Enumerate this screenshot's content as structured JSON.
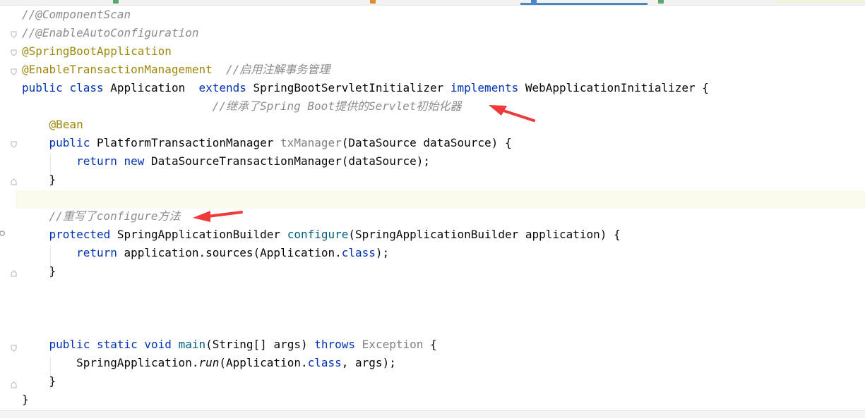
{
  "editor": {
    "lines": [
      {
        "segments": [
          {
            "t": "//@ComponentScan",
            "c": "cm"
          }
        ]
      },
      {
        "segments": [
          {
            "t": "//@EnableAutoConfiguration",
            "c": "cm"
          }
        ]
      },
      {
        "segments": [
          {
            "t": "@SpringBootApplication",
            "c": "an"
          }
        ]
      },
      {
        "segments": [
          {
            "t": "@EnableTransactionManagement",
            "c": "an"
          },
          {
            "t": "  ",
            "c": ""
          },
          {
            "t": "//启用注解事务管理",
            "c": "cm"
          }
        ]
      },
      {
        "segments": [
          {
            "t": "public",
            "c": "kw"
          },
          {
            "t": " ",
            "c": ""
          },
          {
            "t": "class",
            "c": "kw"
          },
          {
            "t": " Application  ",
            "c": ""
          },
          {
            "t": "extends",
            "c": "kw"
          },
          {
            "t": " SpringBootServletInitializer ",
            "c": ""
          },
          {
            "t": "implements",
            "c": "kw"
          },
          {
            "t": " WebApplicationInitializer {",
            "c": ""
          }
        ]
      },
      {
        "segments": [
          {
            "t": "                            ",
            "c": ""
          },
          {
            "t": "//继承了Spring Boot提供的Servlet初始化器",
            "c": "cm"
          }
        ]
      },
      {
        "segments": [
          {
            "t": "    ",
            "c": ""
          },
          {
            "t": "@Bean",
            "c": "an"
          }
        ]
      },
      {
        "segments": [
          {
            "t": "    ",
            "c": ""
          },
          {
            "t": "public",
            "c": "kw"
          },
          {
            "t": " PlatformTransactionManager ",
            "c": ""
          },
          {
            "t": "txManager",
            "c": "un"
          },
          {
            "t": "(DataSource dataSource) {",
            "c": ""
          }
        ]
      },
      {
        "segments": [
          {
            "t": "        ",
            "c": ""
          },
          {
            "t": "return",
            "c": "kw"
          },
          {
            "t": " ",
            "c": ""
          },
          {
            "t": "new",
            "c": "kw"
          },
          {
            "t": " DataSourceTransactionManager(dataSource);",
            "c": ""
          }
        ]
      },
      {
        "segments": [
          {
            "t": "    }",
            "c": ""
          }
        ]
      },
      {
        "segments": []
      },
      {
        "segments": [
          {
            "t": "    ",
            "c": ""
          },
          {
            "t": "//重写了configure方法",
            "c": "cm"
          }
        ]
      },
      {
        "segments": [
          {
            "t": "    ",
            "c": ""
          },
          {
            "t": "protected",
            "c": "kw"
          },
          {
            "t": " SpringApplicationBuilder ",
            "c": ""
          },
          {
            "t": "configure",
            "c": "mt"
          },
          {
            "t": "(SpringApplicationBuilder application) {",
            "c": ""
          }
        ]
      },
      {
        "segments": [
          {
            "t": "        ",
            "c": ""
          },
          {
            "t": "return",
            "c": "kw"
          },
          {
            "t": " application.sources(Application.",
            "c": ""
          },
          {
            "t": "class",
            "c": "kw"
          },
          {
            "t": ");",
            "c": ""
          }
        ]
      },
      {
        "segments": [
          {
            "t": "    }",
            "c": ""
          }
        ]
      },
      {
        "segments": []
      },
      {
        "segments": []
      },
      {
        "segments": []
      },
      {
        "segments": [
          {
            "t": "    ",
            "c": ""
          },
          {
            "t": "public",
            "c": "kw"
          },
          {
            "t": " ",
            "c": ""
          },
          {
            "t": "static",
            "c": "kw"
          },
          {
            "t": " ",
            "c": ""
          },
          {
            "t": "void",
            "c": "kw"
          },
          {
            "t": " ",
            "c": ""
          },
          {
            "t": "main",
            "c": "mt"
          },
          {
            "t": "(String[] args) ",
            "c": ""
          },
          {
            "t": "throws",
            "c": "kw"
          },
          {
            "t": " ",
            "c": ""
          },
          {
            "t": "Exception",
            "c": "un"
          },
          {
            "t": " {",
            "c": ""
          }
        ]
      },
      {
        "segments": [
          {
            "t": "        SpringApplication.",
            "c": ""
          },
          {
            "t": "run",
            "c": "it"
          },
          {
            "t": "(Application.",
            "c": ""
          },
          {
            "t": "class",
            "c": "kw"
          },
          {
            "t": ", args);",
            "c": ""
          }
        ]
      },
      {
        "segments": [
          {
            "t": "    }",
            "c": ""
          }
        ]
      },
      {
        "segments": [
          {
            "t": "}",
            "c": ""
          }
        ]
      }
    ]
  },
  "colors": {
    "keyword": "#0033b3",
    "comment": "#8c8c8c",
    "annotation": "#9e880d",
    "method": "#00627a",
    "unused": "#808080",
    "current_line": "#fcfaed",
    "arrow": "#f03a3a"
  },
  "annotations": [
    {
      "name": "red-arrow-icon",
      "points_to": "//继承了Spring Boot提供的Servlet初始化器"
    },
    {
      "name": "red-arrow-icon",
      "points_to": "//重写了configure方法"
    }
  ]
}
